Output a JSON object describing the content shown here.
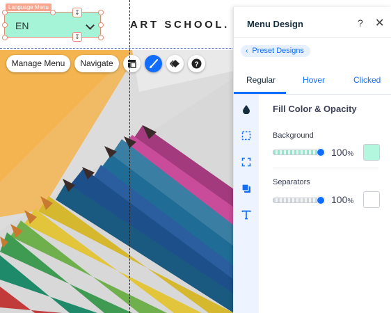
{
  "site": {
    "logo_text": "ART SCHOOL.",
    "language_menu": {
      "tag": "Language Menu",
      "value": "EN"
    }
  },
  "toolbar": {
    "manage_menu": "Manage Menu",
    "navigate": "Navigate",
    "icons": [
      "layout-icon",
      "design-brush-icon",
      "animation-icon",
      "help-icon"
    ]
  },
  "panel": {
    "title": "Menu Design",
    "help": "?",
    "close": "✕",
    "preset_designs": "Preset Designs",
    "tabs": [
      {
        "label": "Regular",
        "active": true
      },
      {
        "label": "Hover",
        "active": false
      },
      {
        "label": "Clicked",
        "active": false
      }
    ],
    "sidebar_icons": [
      "fill-drop-icon",
      "border-icon",
      "corners-icon",
      "shadow-icon",
      "text-icon"
    ],
    "section_title": "Fill Color & Opacity",
    "background": {
      "label": "Background",
      "percent": "100",
      "unit": "%",
      "level": 1.0,
      "color": "#b3f7df"
    },
    "separators": {
      "label": "Separators",
      "percent": "100",
      "unit": "%",
      "level": 1.0,
      "color": "#ffffff"
    }
  },
  "colors": {
    "accent": "#116dff",
    "language_menu_fill": "#a6f4d8",
    "selection_outline": "#e88a74",
    "photo_orange": "#f2b04c"
  }
}
